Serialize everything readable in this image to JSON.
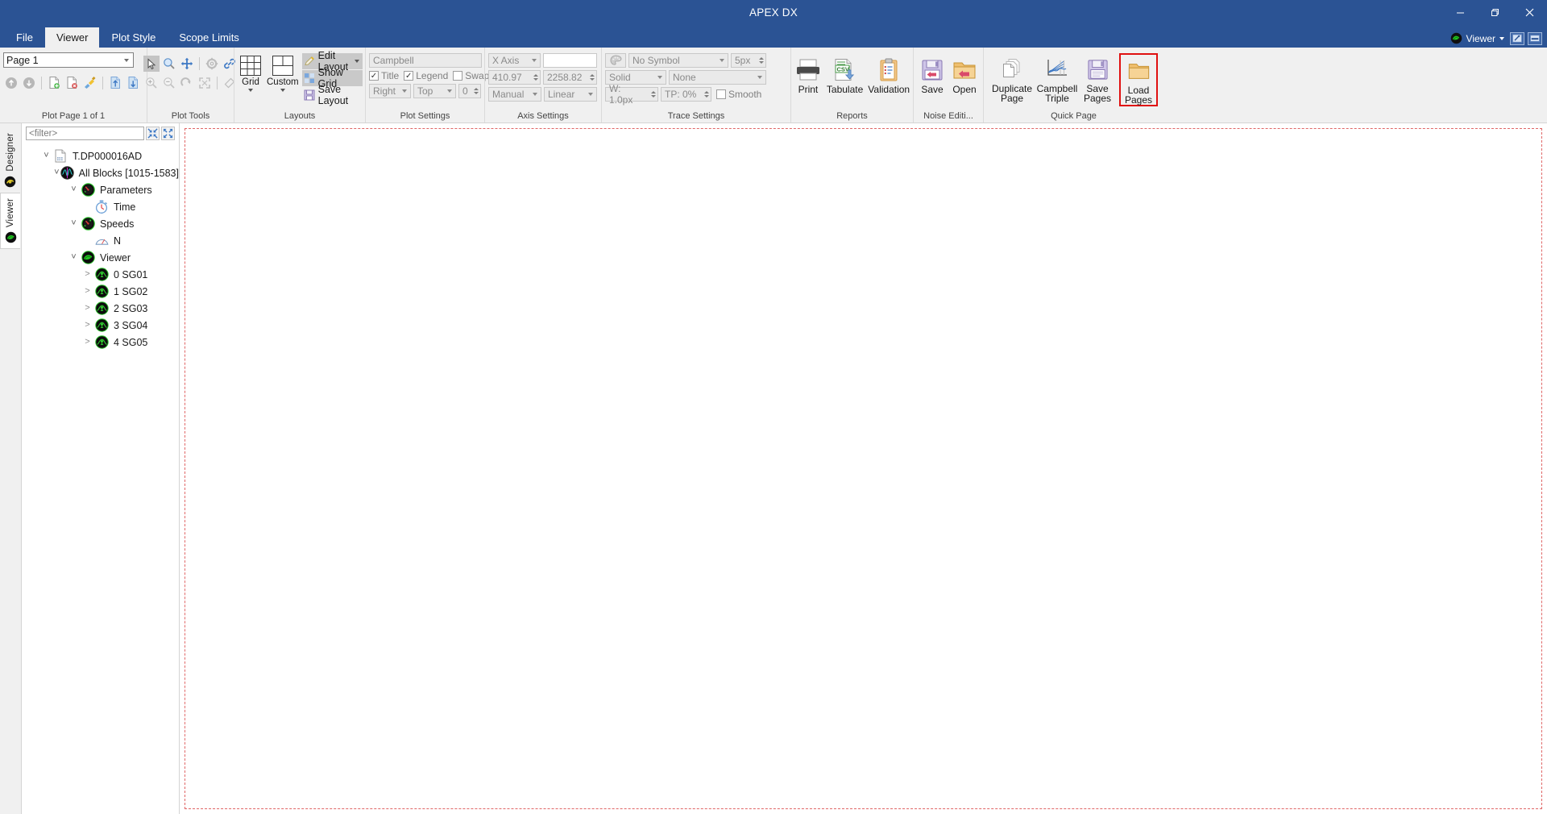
{
  "window": {
    "title": "APEX DX",
    "minimize": "–",
    "restore": "❐",
    "close": "✕"
  },
  "tabs": [
    {
      "label": "File",
      "active": false
    },
    {
      "label": "Viewer",
      "active": true
    },
    {
      "label": "Plot Style",
      "active": false
    },
    {
      "label": "Scope Limits",
      "active": false
    }
  ],
  "tabstrip_right": {
    "account_label": "Viewer",
    "help_icon": "help-icon",
    "minimize_ribbon_icon": "minimize-ribbon-icon"
  },
  "ribbon": {
    "groups": [
      {
        "name": "plot-page",
        "label": "Plot Page 1 of 1"
      },
      {
        "name": "plot-tools",
        "label": "Plot Tools"
      },
      {
        "name": "layouts",
        "label": "Layouts"
      },
      {
        "name": "plot-settings",
        "label": "Plot Settings"
      },
      {
        "name": "axis-settings",
        "label": "Axis Settings"
      },
      {
        "name": "trace-settings",
        "label": "Trace Settings"
      },
      {
        "name": "reports",
        "label": "Reports"
      },
      {
        "name": "noise-editing",
        "label": "Noise Editi..."
      },
      {
        "name": "quick-page",
        "label": "Quick Page"
      }
    ],
    "plot_page": {
      "page_combo_value": "Page 1",
      "quick_icons": [
        "page-up-icon",
        "page-down-icon",
        "new-page-icon",
        "delete-page-icon",
        "clear-page-icon",
        "import-page-icon",
        "export-page-icon"
      ]
    },
    "plot_tools": {
      "row1": [
        "select-arrow-icon",
        "zoom-icon",
        "pan-icon",
        "settings-gear-icon",
        "link-icon"
      ],
      "row2": [
        "zoom-in-icon",
        "zoom-out-icon",
        "redo-icon",
        "fit-icon",
        "eraser-icon"
      ]
    },
    "layouts": {
      "grid_label": "Grid",
      "custom_label": "Custom",
      "edit_layout_label": "Edit Layout",
      "show_grid_label": "Show Grid",
      "save_layout_label": "Save Layout"
    },
    "plot_settings": {
      "title_value": "Campbell",
      "title_checkbox": {
        "label": "Title",
        "checked": true
      },
      "legend_checkbox": {
        "label": "Legend",
        "checked": true
      },
      "swapxy_checkbox": {
        "label": "SwapXY",
        "checked": false
      },
      "legend_h_value": "Right",
      "legend_v_value": "Top",
      "offset_value": "0"
    },
    "axis_settings": {
      "axis_select_value": "X Axis",
      "axis_name_value": "",
      "min_value": "410.97",
      "max_value": "2258.82",
      "scale_mode_value": "Manual",
      "scale_type_value": "Linear"
    },
    "trace_settings": {
      "color_icon": "color-palette-icon",
      "symbol_value": "No Symbol",
      "symbol_size_value": "5px",
      "line_style_value": "Solid",
      "line_pattern_value": "None",
      "width_value": "W: 1.0px",
      "transparency_value": "TP: 0%",
      "smooth_checkbox": {
        "label": "Smooth",
        "checked": false
      }
    },
    "reports": {
      "buttons": [
        {
          "label": "Print",
          "icon": "printer-icon"
        },
        {
          "label": "Tabulate",
          "icon": "csv-export-icon"
        },
        {
          "label": "Validation",
          "icon": "clipboard-checklist-icon"
        }
      ]
    },
    "noise_editing": {
      "buttons": [
        {
          "label": "Save",
          "icon": "save-noise-icon"
        },
        {
          "label": "Open",
          "icon": "open-noise-icon"
        }
      ]
    },
    "quick_page": {
      "buttons": [
        {
          "label1": "Duplicate",
          "label2": "Page",
          "icon": "duplicate-page-icon",
          "highlighted": false
        },
        {
          "label1": "Campbell",
          "label2": "Triple",
          "icon": "campbell-triple-icon",
          "highlighted": false
        },
        {
          "label1": "Save",
          "label2": "Pages",
          "icon": "save-pages-icon",
          "highlighted": false
        },
        {
          "label1": "Load",
          "label2": "Pages",
          "icon": "load-pages-icon",
          "highlighted": true
        }
      ],
      "highlight_color": "#e01010"
    }
  },
  "side_tabs": [
    {
      "label": "Designer",
      "icon": "designer-icon",
      "active": false
    },
    {
      "label": "Viewer",
      "icon": "viewer-icon",
      "active": true
    }
  ],
  "tree_panel": {
    "filter_placeholder": "<filter>",
    "collapse_all_icon": "collapse-all-icon",
    "expand_all_icon": "expand-all-icon",
    "nodes": [
      {
        "label": "T.DP000016AD",
        "depth": 0,
        "expander": "down",
        "icon": "document-data-icon"
      },
      {
        "label": "All Blocks [1015-1583]",
        "depth": 1,
        "expander": "down",
        "icon": "all-blocks-icon"
      },
      {
        "label": "Parameters",
        "depth": 2,
        "expander": "down",
        "icon": "gauge-red-icon"
      },
      {
        "label": "Time",
        "depth": 3,
        "expander": "none",
        "icon": "stopwatch-icon"
      },
      {
        "label": "Speeds",
        "depth": 2,
        "expander": "down",
        "icon": "gauge-green-icon"
      },
      {
        "label": "N",
        "depth": 3,
        "expander": "none",
        "icon": "speedometer-icon"
      },
      {
        "label": "Viewer",
        "depth": 2,
        "expander": "down",
        "icon": "viewer-green-icon"
      },
      {
        "label": "0 SG01",
        "depth": 3,
        "expander": "right",
        "icon": "signal-icon"
      },
      {
        "label": "1 SG02",
        "depth": 3,
        "expander": "right",
        "icon": "signal-icon"
      },
      {
        "label": "2 SG03",
        "depth": 3,
        "expander": "right",
        "icon": "signal-icon"
      },
      {
        "label": "3 SG04",
        "depth": 3,
        "expander": "right",
        "icon": "signal-icon"
      },
      {
        "label": "4 SG05",
        "depth": 3,
        "expander": "right",
        "icon": "signal-icon"
      }
    ]
  },
  "canvas": {
    "border_color": "#e06666",
    "background": "#ffffff"
  }
}
